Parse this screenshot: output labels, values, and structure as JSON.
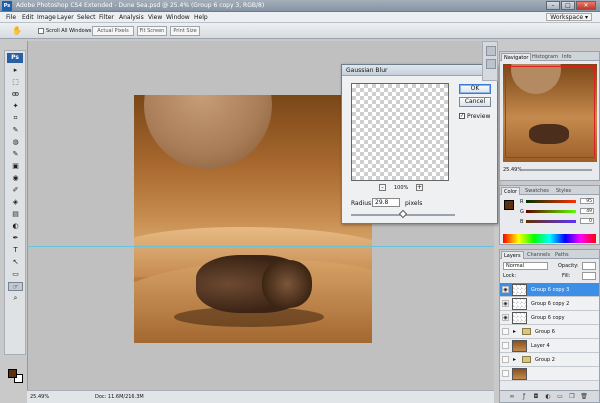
{
  "title_bar": {
    "app_title": "Adobe Photoshop CS4 Extended - Dune Sea.psd @ 25.4% (Group 6 copy 3, RGB/8)",
    "ps_badge": "Ps",
    "min": "–",
    "max": "□",
    "close": "✕"
  },
  "menu": {
    "items": [
      "File",
      "Edit",
      "Image",
      "Layer",
      "Select",
      "Filter",
      "Analysis",
      "View",
      "Window",
      "Help"
    ],
    "workspace": "Workspace ▾"
  },
  "options": {
    "scroll_all": "Scroll All Windows",
    "actual_pixels": "Actual Pixels",
    "fit_screen": "Fit Screen",
    "print_size": "Print Size"
  },
  "toolbox": {
    "badge": "Ps",
    "tools": [
      "▸",
      "⬚",
      "ꙭ",
      "✦",
      "⌗",
      "✎",
      "◍",
      "✎",
      "▣",
      "◉",
      "✐",
      "◈",
      "▤",
      "◐",
      "✒",
      "T",
      "↖",
      "▭",
      "☞",
      "⌕"
    ]
  },
  "gaussian_blur": {
    "title": "Gaussian Blur",
    "close": "x",
    "ok": "OK",
    "cancel": "Cancel",
    "preview_label": "Preview",
    "preview_checked": "✓",
    "zoom_minus": "-",
    "zoom_plus": "+",
    "zoom": "100%",
    "radius_label": "Radius:",
    "radius_value": "29.8",
    "radius_unit": "pixels",
    "radius_slider_fraction": 0.5
  },
  "status": {
    "zoom": "25.49%",
    "doc": "Doc: 11.6M/216.3M"
  },
  "navigator": {
    "tabs": [
      "Navigator",
      "Histogram",
      "Info"
    ],
    "zoom": "25.49%"
  },
  "color_panel": {
    "tabs": [
      "Color",
      "Swatches",
      "Styles"
    ],
    "channels": [
      {
        "label": "R",
        "value": "95",
        "fill": 0.37
      },
      {
        "label": "G",
        "value": "49",
        "fill": 0.19
      },
      {
        "label": "B",
        "value": "0",
        "fill": 0.02
      }
    ],
    "fg_color": "#5a2f12"
  },
  "layers_panel": {
    "tabs": [
      "Layers",
      "Channels",
      "Paths"
    ],
    "blend_mode": "Normal",
    "opacity_label": "Opacity:",
    "opacity_value": "",
    "lock_label": "Lock:",
    "fill_label": "Fill:",
    "fill_value": "",
    "layers": [
      {
        "name": "Group 6 copy 3",
        "visible": true,
        "selected": true,
        "kind": "transparent"
      },
      {
        "name": "Group 6 copy 2",
        "visible": true,
        "selected": false,
        "kind": "transparent"
      },
      {
        "name": "Group 6 copy",
        "visible": true,
        "selected": false,
        "kind": "transparent"
      },
      {
        "name": "Group 6",
        "visible": false,
        "selected": false,
        "kind": "group"
      },
      {
        "name": "Layer 4",
        "visible": false,
        "selected": false,
        "kind": "image"
      },
      {
        "name": "Group 2",
        "visible": false,
        "selected": false,
        "kind": "group"
      }
    ],
    "footer_icons": [
      "link-icon",
      "fx-icon",
      "mask-icon",
      "adjustment-icon",
      "folder-icon",
      "new-layer-icon",
      "trash-icon"
    ]
  }
}
